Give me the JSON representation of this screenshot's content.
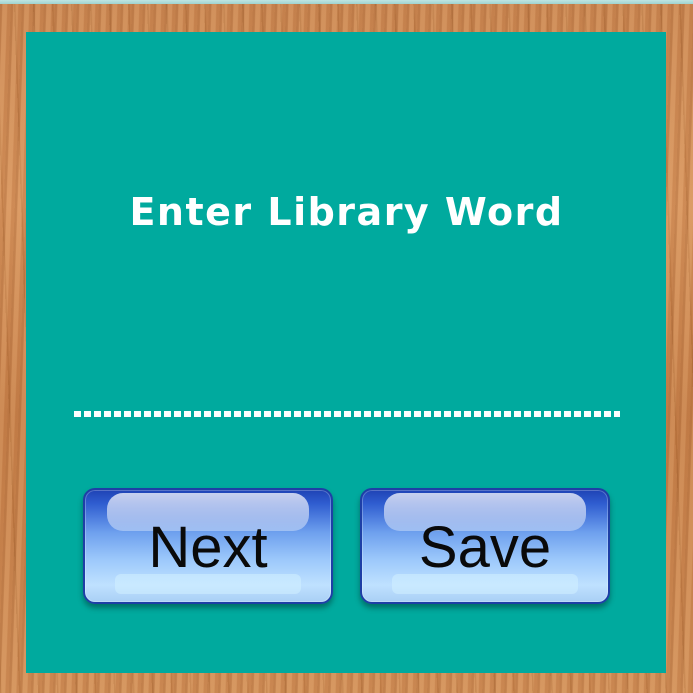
{
  "prompt": {
    "title": "Enter Library Word"
  },
  "word_entry": {
    "value": ""
  },
  "buttons": {
    "next_label": "Next",
    "save_label": "Save"
  },
  "colors": {
    "panel": "#00aa9e",
    "button_blue": "#2f5dd0",
    "text_white": "#ffffff"
  }
}
